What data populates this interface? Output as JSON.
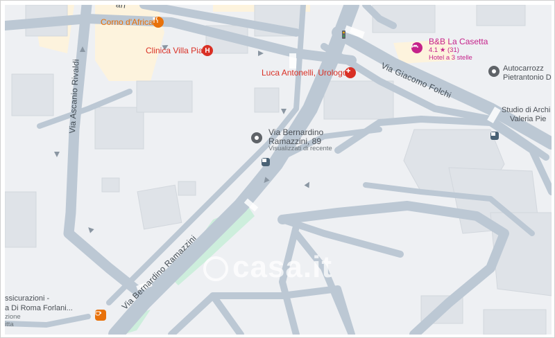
{
  "streets": {
    "rivaldi": "Via Ascanio Rivaldi",
    "folchi": "Via Giacomo Folchi",
    "ramazzini": "Via Bernardino Ramazzini",
    "top_partial": "ari"
  },
  "places": {
    "corno_africa": "Corno d'Africa",
    "clinica": "Clinica Villa Pia",
    "urologo": "Luca Antonelli, Urologo",
    "bb": {
      "name": "B&B La Casetta",
      "rating": "4.1 ★ (31)",
      "type": "Hotel a 3 stelle"
    },
    "autocarrozz_1": "Autocarrozz",
    "autocarrozz_2": "Pietrantonio D",
    "studio_1": "Studio di Archi",
    "studio_2": "Valeria Pie",
    "pin": {
      "line1": "Via Bernardino",
      "line2": "Ramazzini, 89",
      "sub": "Visualizzati di recente"
    },
    "assicurazioni_1": "ssicurazioni -",
    "assicurazioni_2": "a Di Roma Forlani...",
    "assicurazioni_3": "zione",
    "assicurazioni_4": "itta"
  },
  "watermark": "casa.it",
  "colors": {
    "road": "#bcc8d4",
    "background": "#eef0f3",
    "building": "#dfe3e8",
    "park": "#cdeedc",
    "sand": "#fdf3dd",
    "red_poi": "#d93025",
    "orange_poi": "#e8710a",
    "pink_poi": "#c5228a"
  }
}
